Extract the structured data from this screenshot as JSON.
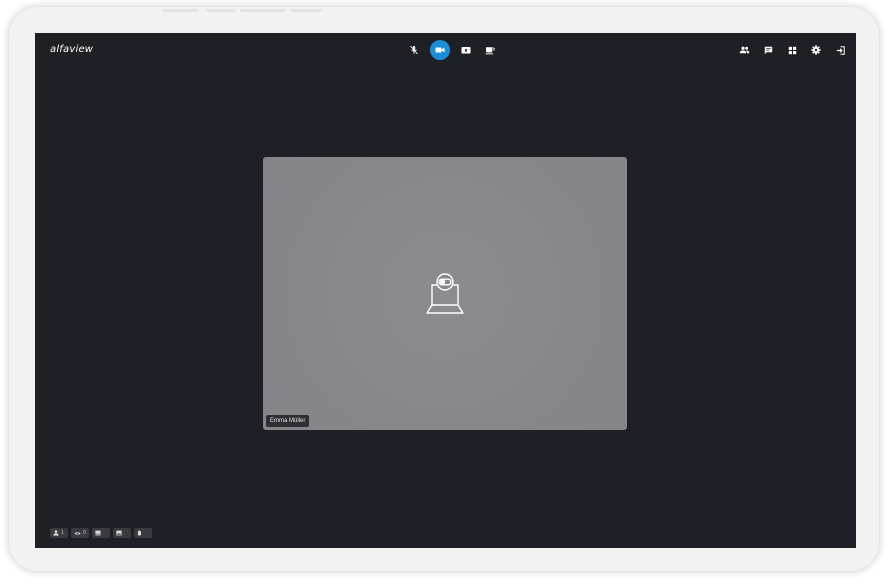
{
  "app": {
    "logo": "alfaview"
  },
  "toolbar": {
    "center": [
      {
        "icon": "mic-off-icon",
        "label": "",
        "active": false
      },
      {
        "icon": "camera-icon",
        "label": "",
        "active": true
      },
      {
        "icon": "screen-share-icon",
        "label": "",
        "active": false
      },
      {
        "icon": "coffee-break-icon",
        "label": "",
        "active": false
      }
    ],
    "right": [
      {
        "icon": "participants-icon"
      },
      {
        "icon": "chat-icon"
      },
      {
        "icon": "layout-grid-icon"
      },
      {
        "icon": "settings-icon"
      },
      {
        "icon": "exit-icon"
      }
    ]
  },
  "video": {
    "participant_name": "Emma Müller",
    "camera_off_icon": "camera-off-laptop-icon"
  },
  "bottom_bar": {
    "participants_count": "1",
    "viewers_count": "0"
  },
  "colors": {
    "background": "#1f2025",
    "accent": "#1a8fd8",
    "tile": "#88878c",
    "frame": "#f2f2f3"
  }
}
